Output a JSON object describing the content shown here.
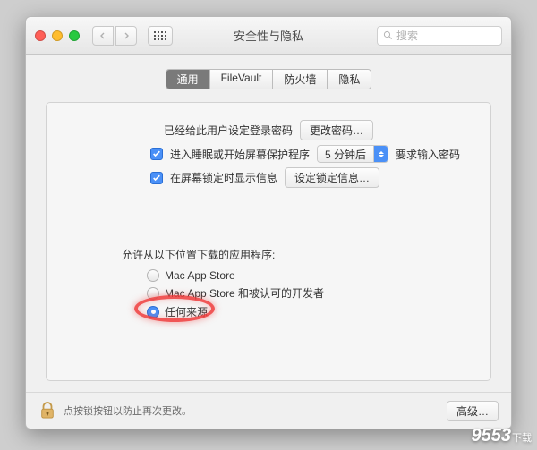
{
  "window": {
    "title": "安全性与隐私"
  },
  "toolbar": {
    "search_placeholder": "搜索"
  },
  "tabs": [
    "通用",
    "FileVault",
    "防火墙",
    "隐私"
  ],
  "selected_tab": 0,
  "panel": {
    "login_password_row": {
      "label": "已经给此用户设定登录密码",
      "button": "更改密码…"
    },
    "require_password": {
      "checked": true,
      "pre_label": "进入睡眠或开始屏幕保护程序",
      "select_value": "5 分钟后",
      "post_label": "要求输入密码"
    },
    "screen_lock": {
      "checked": true,
      "label": "在屏幕锁定时显示信息",
      "button": "设定锁定信息…"
    },
    "allow_from": {
      "label": "允许从以下位置下载的应用程序:",
      "options": [
        {
          "label": "Mac App Store",
          "selected": false
        },
        {
          "label": "Mac App Store 和被认可的开发者",
          "selected": false
        },
        {
          "label": "任何来源",
          "selected": true
        }
      ]
    }
  },
  "footer": {
    "lock_text": "点按锁按钮以防止再次更改。",
    "advanced_button": "高级…"
  },
  "watermark": {
    "main": "9553",
    "suffix": "下载"
  }
}
